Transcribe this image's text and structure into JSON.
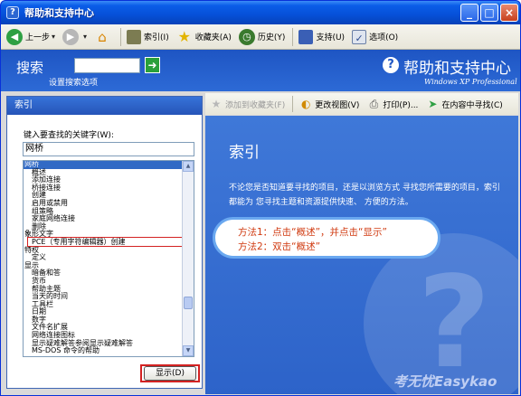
{
  "window": {
    "title": "帮助和支持中心",
    "title_buttons": [
      "_",
      "□",
      "×"
    ]
  },
  "toolbar": {
    "back": "上一步",
    "index": "索引(I)",
    "favorites": "收藏夹(A)",
    "history": "历史(Y)",
    "support": "支持(U)",
    "options": "选项(O)"
  },
  "search": {
    "label": "搜索",
    "value": "",
    "go_icon": "➜",
    "options_link": "设置搜索选项"
  },
  "brand": {
    "title": "帮助和支持中心",
    "subtitle": "Windows XP Professional"
  },
  "left": {
    "header": "索引",
    "keyword_label": "键入要查找的关键字(W):",
    "keyword_value": "网桥",
    "items": [
      {
        "text": "网桥",
        "level": 0,
        "selected": true
      },
      {
        "text": "概述",
        "level": 1
      },
      {
        "text": "添加连接",
        "level": 1
      },
      {
        "text": "桥接连接",
        "level": 1
      },
      {
        "text": "创建",
        "level": 1
      },
      {
        "text": "启用或禁用",
        "level": 1
      },
      {
        "text": "组策略",
        "level": 1
      },
      {
        "text": "家庭网络连接",
        "level": 1
      },
      {
        "text": "删除",
        "level": 1
      },
      {
        "text": "象形文字",
        "level": 0
      },
      {
        "text": "PCE（专用字符编辑器）创建",
        "level": 1
      },
      {
        "text": "特权",
        "level": 0
      },
      {
        "text": "定义",
        "level": 1
      },
      {
        "text": "显示",
        "level": 0
      },
      {
        "text": "暗备和答",
        "level": 1
      },
      {
        "text": "货币",
        "level": 1
      },
      {
        "text": "帮助主题",
        "level": 1
      },
      {
        "text": "当天的时间",
        "level": 1
      },
      {
        "text": "工具栏",
        "level": 1
      },
      {
        "text": "日期",
        "level": 1
      },
      {
        "text": "数字",
        "level": 1
      },
      {
        "text": "文件名扩展",
        "level": 1
      },
      {
        "text": "网络连接图标",
        "level": 1
      },
      {
        "text": "显示疑难解答参阅显示疑难解答",
        "level": 1
      },
      {
        "text": "MS-DOS 命令的帮助",
        "level": 1
      }
    ],
    "show_button": "显示(D)"
  },
  "right_toolbar": {
    "add_favorites": "添加到收藏夹(F)",
    "change_view": "更改视图(V)",
    "print": "打印(P)...",
    "find_in_content": "在内容中寻找(C)"
  },
  "right": {
    "title": "索引",
    "description": "不论您是否知道要寻找的项目，还是以浏览方式 寻找您所需要的项目，索引都能为 您寻找主题和资源提供快速、 方便的方法。",
    "callout_line1": "方法1：点击“概述”，并点击“显示”",
    "callout_line2": "方法2：双击“概述”",
    "watermark": "考无忧Easykao"
  }
}
